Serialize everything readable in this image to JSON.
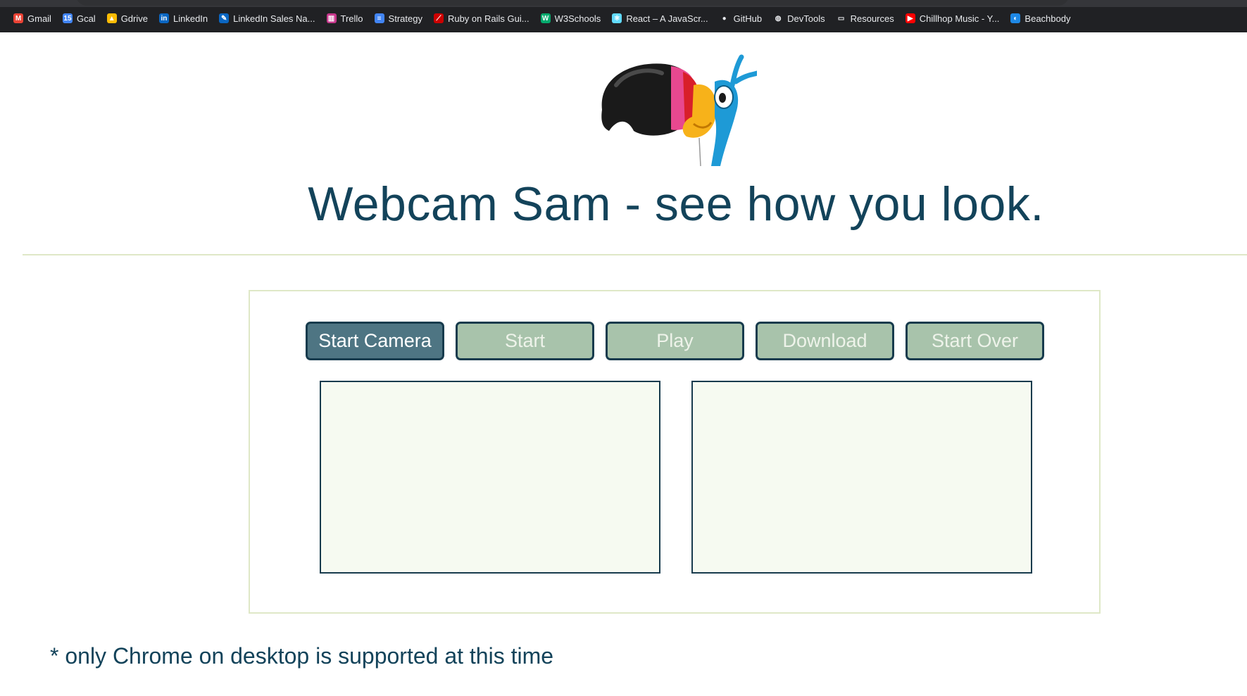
{
  "browser": {
    "bookmarks": [
      {
        "label": "Gmail",
        "icon": "gmail-icon",
        "color": "#ea4335",
        "glyph": "M"
      },
      {
        "label": "Gcal",
        "icon": "calendar-icon",
        "color": "#4285f4",
        "glyph": "15"
      },
      {
        "label": "Gdrive",
        "icon": "drive-icon",
        "color": "#fbbc04",
        "glyph": "▲"
      },
      {
        "label": "LinkedIn",
        "icon": "linkedin-icon",
        "color": "#0a66c2",
        "glyph": "in"
      },
      {
        "label": "LinkedIn Sales Na...",
        "icon": "linkedin-sales-icon",
        "color": "#0a66c2",
        "glyph": "✎"
      },
      {
        "label": "Trello",
        "icon": "trello-icon",
        "color": "#c7378c",
        "glyph": "▥"
      },
      {
        "label": "Strategy",
        "icon": "docs-icon",
        "color": "#4285f4",
        "glyph": "≡"
      },
      {
        "label": "Ruby on Rails Gui...",
        "icon": "rails-icon",
        "color": "#cc0000",
        "glyph": "⟋"
      },
      {
        "label": "W3Schools",
        "icon": "w3schools-icon",
        "color": "#04aa6d",
        "glyph": "W"
      },
      {
        "label": "React – A JavaScr...",
        "icon": "react-icon",
        "color": "#61dafb",
        "glyph": "⚛"
      },
      {
        "label": "GitHub",
        "icon": "github-icon",
        "color": "#e8eaed",
        "glyph": "●"
      },
      {
        "label": "DevTools",
        "icon": "globe-icon",
        "color": "#e8eaed",
        "glyph": "◍"
      },
      {
        "label": "Resources",
        "icon": "folder-icon",
        "color": "#e8eaed",
        "glyph": "▭"
      },
      {
        "label": "Chillhop Music - Y...",
        "icon": "youtube-icon",
        "color": "#ff0000",
        "glyph": "▶"
      },
      {
        "label": "Beachbody",
        "icon": "beachbody-icon",
        "color": "#1e88e5",
        "glyph": "◐"
      }
    ]
  },
  "header": {
    "title": "Webcam Sam - see how you look."
  },
  "controls": {
    "start_camera": "Start Camera",
    "start": "Start",
    "play": "Play",
    "download": "Download",
    "start_over": "Start Over"
  },
  "footer": {
    "note": "* only Chrome on desktop is supported at this time"
  },
  "colors": {
    "title": "#13435a",
    "button_active": "#4e7583",
    "button_disabled": "#a8c3ab",
    "button_border": "#173b4d",
    "panel_border": "#dfe8c7",
    "video_bg": "#f6faf1"
  }
}
